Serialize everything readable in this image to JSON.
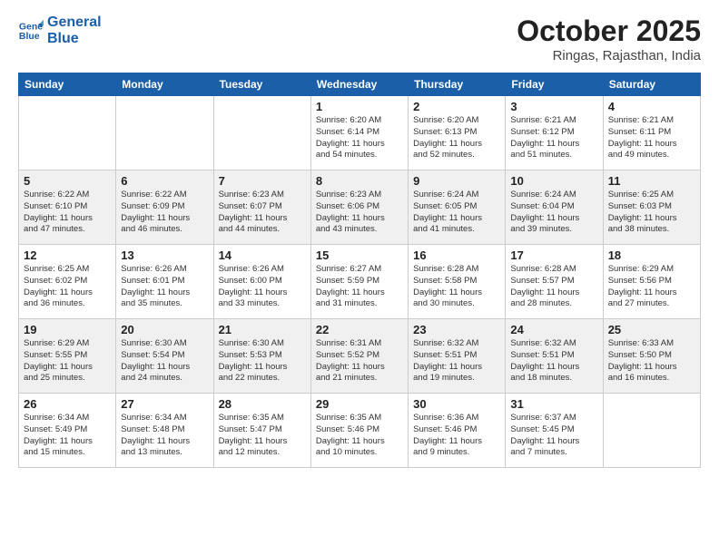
{
  "header": {
    "logo_line1": "General",
    "logo_line2": "Blue",
    "month": "October 2025",
    "location": "Ringas, Rajasthan, India"
  },
  "days_of_week": [
    "Sunday",
    "Monday",
    "Tuesday",
    "Wednesday",
    "Thursday",
    "Friday",
    "Saturday"
  ],
  "weeks": [
    [
      {
        "num": "",
        "info": ""
      },
      {
        "num": "",
        "info": ""
      },
      {
        "num": "",
        "info": ""
      },
      {
        "num": "1",
        "info": "Sunrise: 6:20 AM\nSunset: 6:14 PM\nDaylight: 11 hours\nand 54 minutes."
      },
      {
        "num": "2",
        "info": "Sunrise: 6:20 AM\nSunset: 6:13 PM\nDaylight: 11 hours\nand 52 minutes."
      },
      {
        "num": "3",
        "info": "Sunrise: 6:21 AM\nSunset: 6:12 PM\nDaylight: 11 hours\nand 51 minutes."
      },
      {
        "num": "4",
        "info": "Sunrise: 6:21 AM\nSunset: 6:11 PM\nDaylight: 11 hours\nand 49 minutes."
      }
    ],
    [
      {
        "num": "5",
        "info": "Sunrise: 6:22 AM\nSunset: 6:10 PM\nDaylight: 11 hours\nand 47 minutes."
      },
      {
        "num": "6",
        "info": "Sunrise: 6:22 AM\nSunset: 6:09 PM\nDaylight: 11 hours\nand 46 minutes."
      },
      {
        "num": "7",
        "info": "Sunrise: 6:23 AM\nSunset: 6:07 PM\nDaylight: 11 hours\nand 44 minutes."
      },
      {
        "num": "8",
        "info": "Sunrise: 6:23 AM\nSunset: 6:06 PM\nDaylight: 11 hours\nand 43 minutes."
      },
      {
        "num": "9",
        "info": "Sunrise: 6:24 AM\nSunset: 6:05 PM\nDaylight: 11 hours\nand 41 minutes."
      },
      {
        "num": "10",
        "info": "Sunrise: 6:24 AM\nSunset: 6:04 PM\nDaylight: 11 hours\nand 39 minutes."
      },
      {
        "num": "11",
        "info": "Sunrise: 6:25 AM\nSunset: 6:03 PM\nDaylight: 11 hours\nand 38 minutes."
      }
    ],
    [
      {
        "num": "12",
        "info": "Sunrise: 6:25 AM\nSunset: 6:02 PM\nDaylight: 11 hours\nand 36 minutes."
      },
      {
        "num": "13",
        "info": "Sunrise: 6:26 AM\nSunset: 6:01 PM\nDaylight: 11 hours\nand 35 minutes."
      },
      {
        "num": "14",
        "info": "Sunrise: 6:26 AM\nSunset: 6:00 PM\nDaylight: 11 hours\nand 33 minutes."
      },
      {
        "num": "15",
        "info": "Sunrise: 6:27 AM\nSunset: 5:59 PM\nDaylight: 11 hours\nand 31 minutes."
      },
      {
        "num": "16",
        "info": "Sunrise: 6:28 AM\nSunset: 5:58 PM\nDaylight: 11 hours\nand 30 minutes."
      },
      {
        "num": "17",
        "info": "Sunrise: 6:28 AM\nSunset: 5:57 PM\nDaylight: 11 hours\nand 28 minutes."
      },
      {
        "num": "18",
        "info": "Sunrise: 6:29 AM\nSunset: 5:56 PM\nDaylight: 11 hours\nand 27 minutes."
      }
    ],
    [
      {
        "num": "19",
        "info": "Sunrise: 6:29 AM\nSunset: 5:55 PM\nDaylight: 11 hours\nand 25 minutes."
      },
      {
        "num": "20",
        "info": "Sunrise: 6:30 AM\nSunset: 5:54 PM\nDaylight: 11 hours\nand 24 minutes."
      },
      {
        "num": "21",
        "info": "Sunrise: 6:30 AM\nSunset: 5:53 PM\nDaylight: 11 hours\nand 22 minutes."
      },
      {
        "num": "22",
        "info": "Sunrise: 6:31 AM\nSunset: 5:52 PM\nDaylight: 11 hours\nand 21 minutes."
      },
      {
        "num": "23",
        "info": "Sunrise: 6:32 AM\nSunset: 5:51 PM\nDaylight: 11 hours\nand 19 minutes."
      },
      {
        "num": "24",
        "info": "Sunrise: 6:32 AM\nSunset: 5:51 PM\nDaylight: 11 hours\nand 18 minutes."
      },
      {
        "num": "25",
        "info": "Sunrise: 6:33 AM\nSunset: 5:50 PM\nDaylight: 11 hours\nand 16 minutes."
      }
    ],
    [
      {
        "num": "26",
        "info": "Sunrise: 6:34 AM\nSunset: 5:49 PM\nDaylight: 11 hours\nand 15 minutes."
      },
      {
        "num": "27",
        "info": "Sunrise: 6:34 AM\nSunset: 5:48 PM\nDaylight: 11 hours\nand 13 minutes."
      },
      {
        "num": "28",
        "info": "Sunrise: 6:35 AM\nSunset: 5:47 PM\nDaylight: 11 hours\nand 12 minutes."
      },
      {
        "num": "29",
        "info": "Sunrise: 6:35 AM\nSunset: 5:46 PM\nDaylight: 11 hours\nand 10 minutes."
      },
      {
        "num": "30",
        "info": "Sunrise: 6:36 AM\nSunset: 5:46 PM\nDaylight: 11 hours\nand 9 minutes."
      },
      {
        "num": "31",
        "info": "Sunrise: 6:37 AM\nSunset: 5:45 PM\nDaylight: 11 hours\nand 7 minutes."
      },
      {
        "num": "",
        "info": ""
      }
    ]
  ]
}
